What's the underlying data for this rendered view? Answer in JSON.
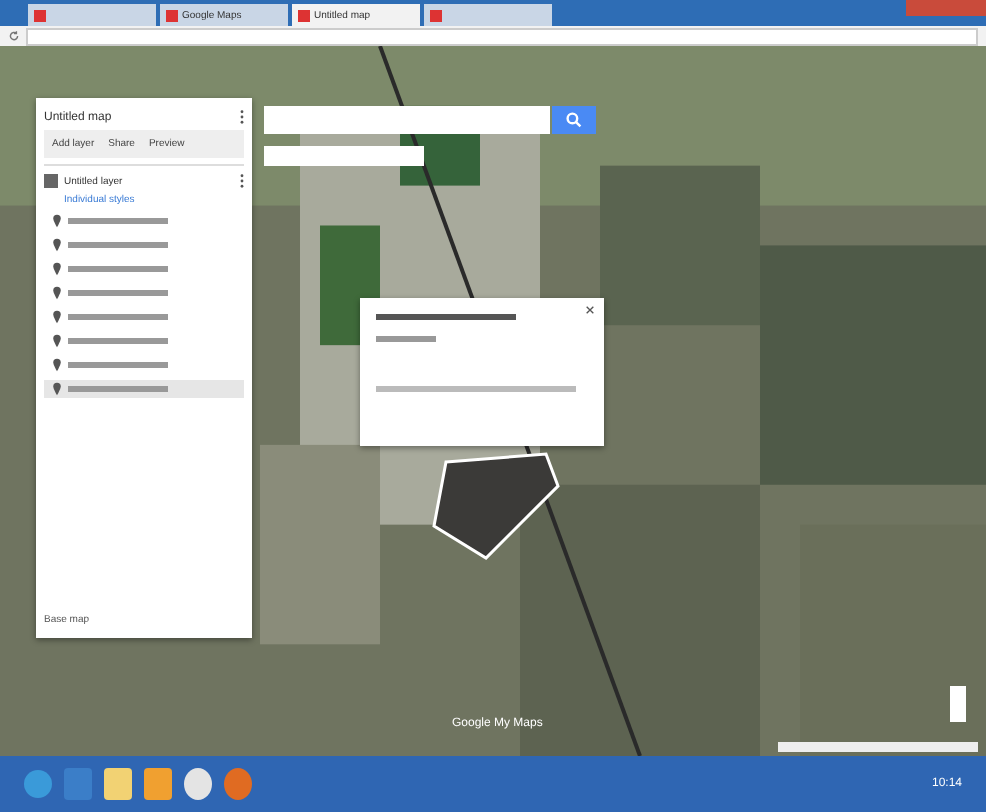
{
  "browser": {
    "tabs": [
      {
        "selected": false
      },
      {
        "label": "Google Maps",
        "selected": false
      },
      {
        "label": "Untitled map",
        "selected": true
      },
      {
        "selected": false
      }
    ]
  },
  "panel": {
    "title": "Untitled map",
    "actions": [
      "Add layer",
      "Share",
      "Preview"
    ],
    "layers": [
      {
        "title": "Untitled layer",
        "checked": true,
        "style_label": "Individual styles",
        "places": [
          {
            "selected": false
          },
          {
            "selected": false
          },
          {
            "selected": false
          },
          {
            "selected": false
          },
          {
            "selected": false
          },
          {
            "selected": false
          },
          {
            "selected": false
          },
          {
            "selected": true
          }
        ]
      }
    ],
    "base_map": "Base map"
  },
  "map": {
    "logo": "Google My Maps"
  },
  "taskbar": {
    "time": "10:14"
  }
}
